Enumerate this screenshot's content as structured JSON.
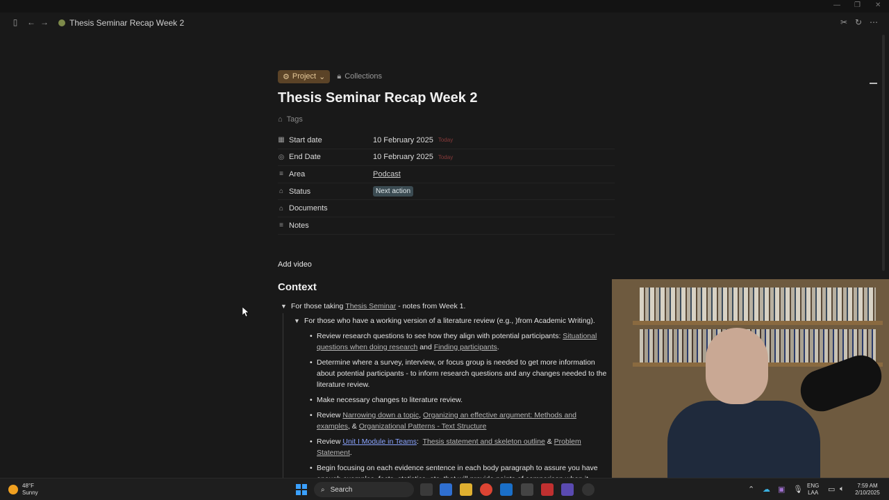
{
  "window": {
    "title": "Thesis Seminar Recap Week 2"
  },
  "nav": {
    "sidebar_icon": "sidebar-toggle-icon",
    "back_icon": "arrow-left-icon",
    "forward_icon": "arrow-right-icon",
    "breadcrumb": "Thesis Seminar Recap Week 2"
  },
  "header": {
    "project_label": "Project",
    "collections_label": "Collections",
    "title": "Thesis Seminar Recap Week 2",
    "tags_label": "Tags"
  },
  "properties": [
    {
      "icon": "calendar-icon",
      "key": "Start date",
      "value": "10 February 2025",
      "badge": "Today"
    },
    {
      "icon": "clock-icon",
      "key": "End Date",
      "value": "10 February 2025",
      "badge": "Today"
    },
    {
      "icon": "list-icon",
      "key": "Area",
      "value": "Podcast"
    },
    {
      "icon": "tag-icon",
      "key": "Status",
      "value": "Next action"
    },
    {
      "icon": "tag-icon",
      "key": "Documents",
      "value": ""
    },
    {
      "icon": "list-icon",
      "key": "Notes",
      "value": ""
    }
  ],
  "add_video": "Add video",
  "context": {
    "heading": "Context",
    "intro_prefix": "For those taking ",
    "intro_link": "Thesis Seminar",
    "intro_suffix": " - notes from Week 1.",
    "sub_heading": "For those who have a working version of a literature review (e.g., )from Academic Writing).",
    "b1_text": "Review research questions to see how they align with potential participants: ",
    "b1_link1": "Situational questions when doing research",
    "b1_and": " and ",
    "b1_link2": "Finding participants",
    "b1_end": ".",
    "b2": "Determine where a survey, interview, or focus group is needed to get more information about potential participants - to inform research questions and any changes needed to the literature review.",
    "b3": "Make necessary changes to literature review.",
    "b4_text": "Review ",
    "b4_link1": "Narrowing down a topic",
    "b4_sep": ", ",
    "b4_link2": "Organizing an effective argument: Methods and examples",
    "b4_amp": ", & ",
    "b4_link3": "Organizational Patterns - Text Structure",
    "b5_text": "Review ",
    "b5_link1": "Unit I Module in Teams",
    "b5_colon": ":  ",
    "b5_link2": "Thesis statement and skeleton outline",
    "b5_amp": " & ",
    "b5_link3": "Problem Statement",
    "b5_end": ".",
    "b6": "Begin focusing on each evidence sentence in each body paragraph to assure you have enough examples, facts, statistics, etc. that will provide points of comparison when it"
  },
  "taskbar": {
    "weather_temp": "48°F",
    "weather_desc": "Sunny",
    "search_placeholder": "Search",
    "lang_1": "ENG",
    "lang_2": "LAA",
    "time": "7:59 AM",
    "date": "2/10/2025"
  }
}
